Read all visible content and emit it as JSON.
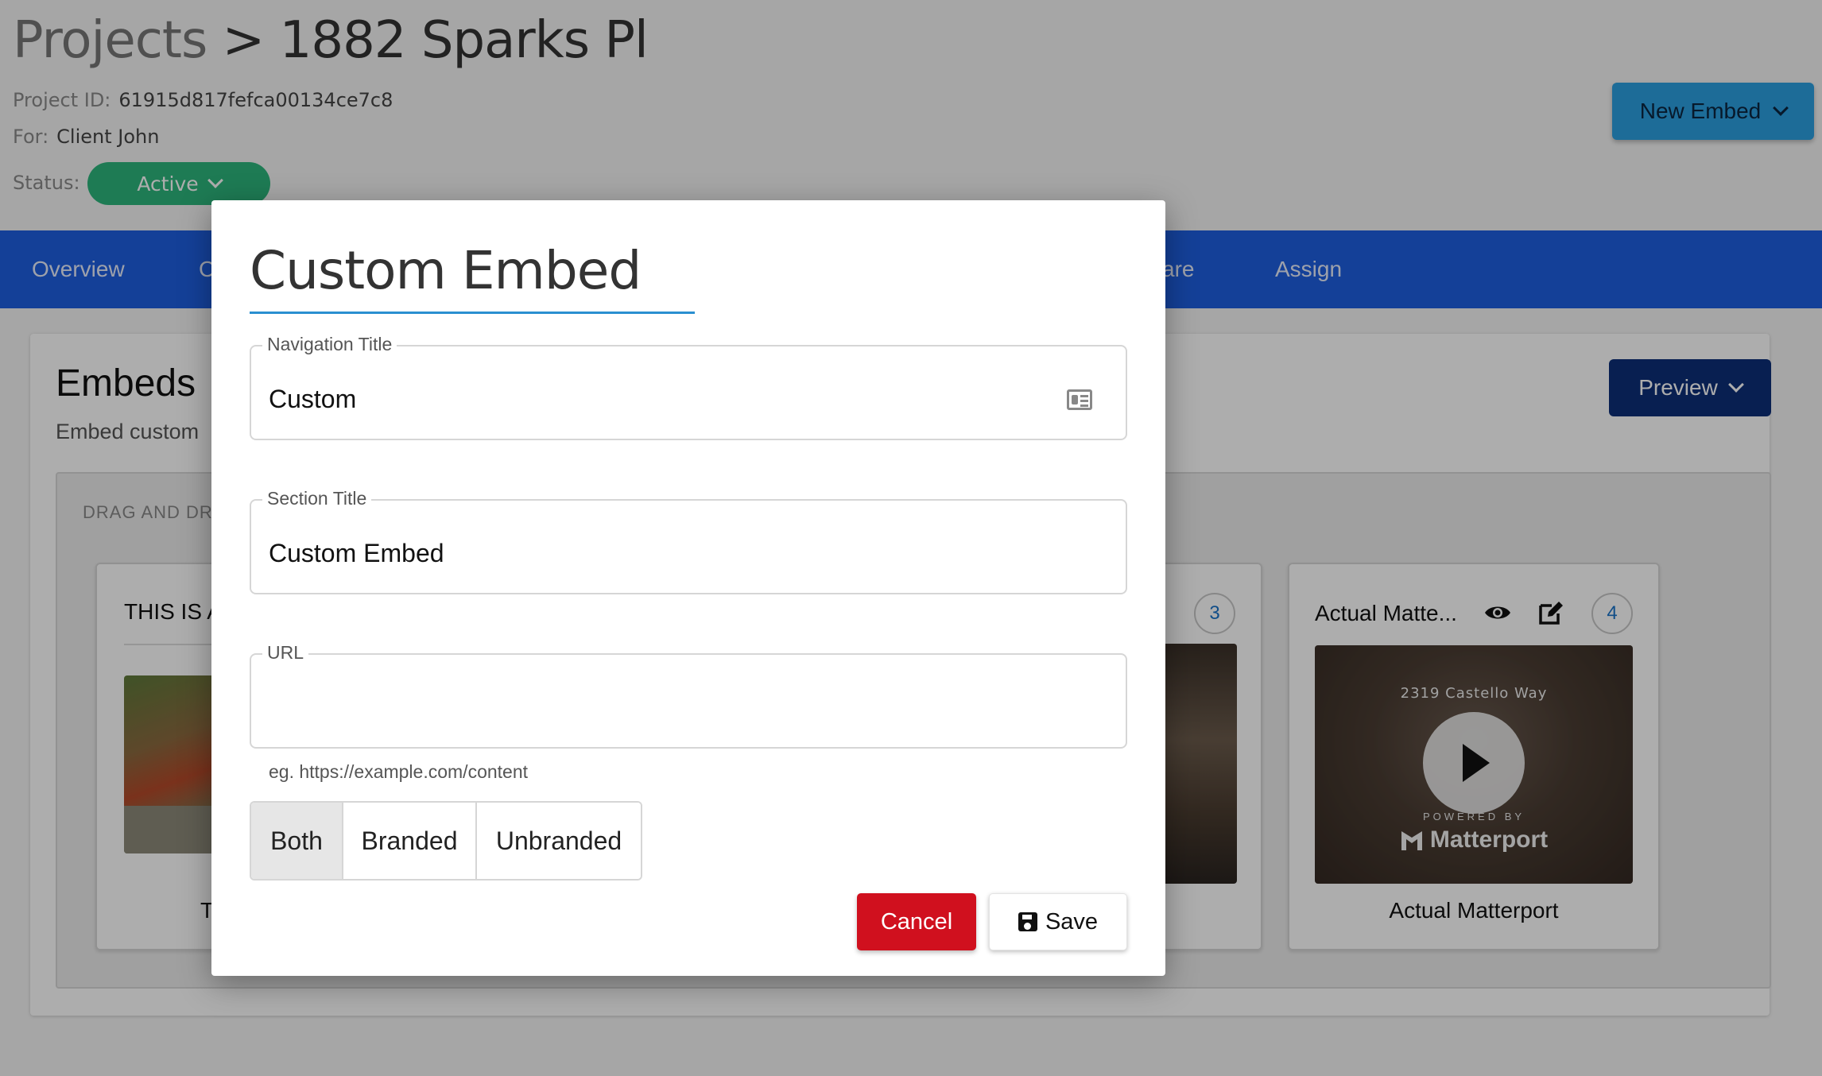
{
  "header": {
    "breadcrumb_root": "Projects",
    "breadcrumb_separator": ">",
    "breadcrumb_current": "1882 Sparks Pl",
    "project_id_label": "Project ID:",
    "project_id_value": "61915d817fefca00134ce7c8",
    "for_label": "For:",
    "for_value": "Client John",
    "status_label": "Status:",
    "status_value": "Active",
    "new_embed_label": "New Embed"
  },
  "nav": {
    "items": [
      {
        "label": "Overview"
      },
      {
        "label": "C"
      },
      {
        "label": "are"
      },
      {
        "label": "Assign"
      }
    ]
  },
  "embeds": {
    "title": "Embeds",
    "subtitle": "Embed custom",
    "preview_label": "Preview",
    "drop_label": "DRAG AND DRO",
    "cards": [
      {
        "title": "THIS IS A",
        "caption": "T"
      },
      {
        "badge": "3"
      },
      {
        "title": "Actual Matte...",
        "badge": "4",
        "thumb_address": "2319 Castello Way",
        "thumb_powered": "POWERED BY",
        "thumb_brand": "Matterport",
        "caption": "Actual Matterport"
      }
    ]
  },
  "modal": {
    "title": "Custom Embed",
    "fields": {
      "navigation_title": {
        "label": "Navigation Title",
        "value": "Custom"
      },
      "section_title": {
        "label": "Section Title",
        "value": "Custom Embed"
      },
      "url": {
        "label": "URL",
        "value": "",
        "hint": "eg. https://example.com/content"
      }
    },
    "segments": [
      "Both",
      "Branded",
      "Unbranded"
    ],
    "cancel_label": "Cancel",
    "save_label": "Save"
  },
  "colors": {
    "status_green": "#2db67d",
    "new_embed_blue": "#2b9fe0",
    "nav_blue": "#1e5fe0",
    "preview_navy": "#0c2e78",
    "cancel_red": "#d0101e",
    "title_rule": "#2a8fd0"
  }
}
